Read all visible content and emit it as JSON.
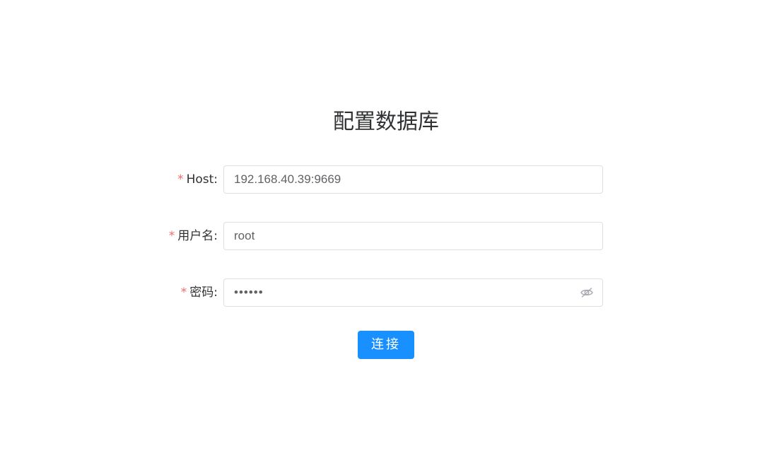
{
  "page": {
    "title": "配置数据库"
  },
  "form": {
    "host": {
      "required_mark": "*",
      "label": "Host:",
      "value": "192.168.40.39:9669"
    },
    "username": {
      "required_mark": "*",
      "label": "用户名:",
      "value": "root"
    },
    "password": {
      "required_mark": "*",
      "label": "密码:",
      "value": "••••••",
      "toggle_icon": "eye-slash-icon"
    },
    "submit_label": "连接"
  },
  "colors": {
    "primary": "#1890ff",
    "required": "#f56c6c",
    "border": "#dcdfe6"
  }
}
